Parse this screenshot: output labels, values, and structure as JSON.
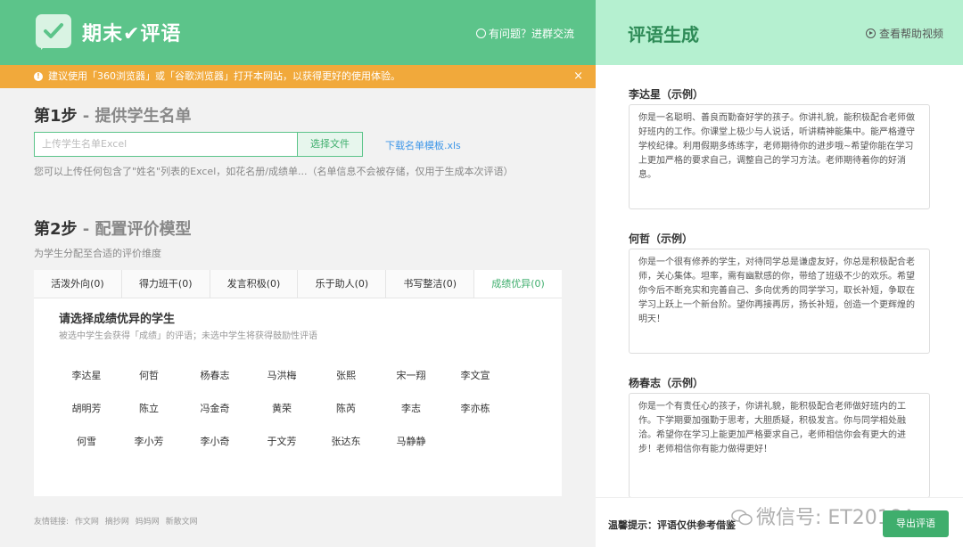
{
  "header": {
    "brand": "期末✔评语",
    "help_link": "有问题？进群交流"
  },
  "banner": {
    "text": "建议使用「360浏览器」或「谷歌浏览器」打开本网站，以获得更好的使用体验。",
    "close": "×"
  },
  "step1": {
    "num": "第1步",
    "title": " - 提供学生名单",
    "input_placeholder": "上传学生名单Excel",
    "choose_file": "选择文件",
    "download_link": "下载名单模板.xls",
    "hint": "您可以上传任何包含了\"姓名\"列表的Excel，如花名册/成绩单...（名单信息不会被存储，仅用于生成本次评语）"
  },
  "step2": {
    "num": "第2步",
    "title": " - 配置评价模型",
    "hint": "为学生分配至合适的评价维度",
    "tabs": [
      {
        "label": "活泼外向(0)"
      },
      {
        "label": "得力班干(0)"
      },
      {
        "label": "发言积极(0)"
      },
      {
        "label": "乐于助人(0)"
      },
      {
        "label": "书写整洁(0)"
      },
      {
        "label": "成绩优异(0)"
      }
    ],
    "panel_title": "请选择成绩优异的学生",
    "panel_sub": "被选中学生会获得「成绩」的评语；未选中学生将获得鼓励性评语",
    "students": [
      "李达星",
      "何哲",
      "杨春志",
      "马洪梅",
      "张熙",
      "宋一翔",
      "李文宣",
      "胡明芳",
      "陈立",
      "冯金奇",
      "黄荣",
      "陈芮",
      "李志",
      "李亦栋",
      "何雪",
      "李小芳",
      "李小奇",
      "于文芳",
      "张达东",
      "马静静"
    ]
  },
  "footer": {
    "label": "友情链接:",
    "links": [
      "作文网",
      "摘抄网",
      "妈妈网",
      "新散文网"
    ]
  },
  "right": {
    "title": "评语生成",
    "video_link": "查看帮助视频",
    "samples": [
      {
        "name": "李达星（示例）",
        "text": "你是一名聪明、善良而勤奋好学的孩子。你讲礼貌，能积极配合老师做好班内的工作。你课堂上极少与人说话，听讲精神能集中。能严格遵守学校纪律。利用假期多练练字，老师期待你的进步哦~希望你能在学习上更加严格的要求自己，调整自己的学习方法。老师期待着你的好消息。"
      },
      {
        "name": "何哲（示例）",
        "text": "你是一个很有修养的学生，对待同学总是谦虚友好，你总是积极配合老师，关心集体。坦率，需有幽默感的你，带给了班级不少的欢乐。希望你今后不断充实和完善自己、多向优秀的同学学习，取长补短，争取在学习上跃上一个新台阶。望你再接再厉，扬长补短，创造一个更辉煌的明天！"
      },
      {
        "name": "杨春志（示例）",
        "text": "你是一个有责任心的孩子，你讲礼貌，能积极配合老师做好班内的工作。下学期要加强勤于思考，大胆质疑，积极发言。你与同学相处融洽。希望你在学习上能更加严格要求自己，老师相信你会有更大的进步！老师相信你有能力做得更好！"
      }
    ],
    "tip": "温馨提示：评语仅供参考借鉴",
    "watermark": "微信号: ET2018A",
    "export_button": "导出评语"
  },
  "colors": {
    "brand_green": "#5cc48a",
    "accent_green": "#3fae6d",
    "banner_orange": "#f1a93b",
    "right_header": "#b5f0d0",
    "link_blue": "#3f97e8"
  }
}
